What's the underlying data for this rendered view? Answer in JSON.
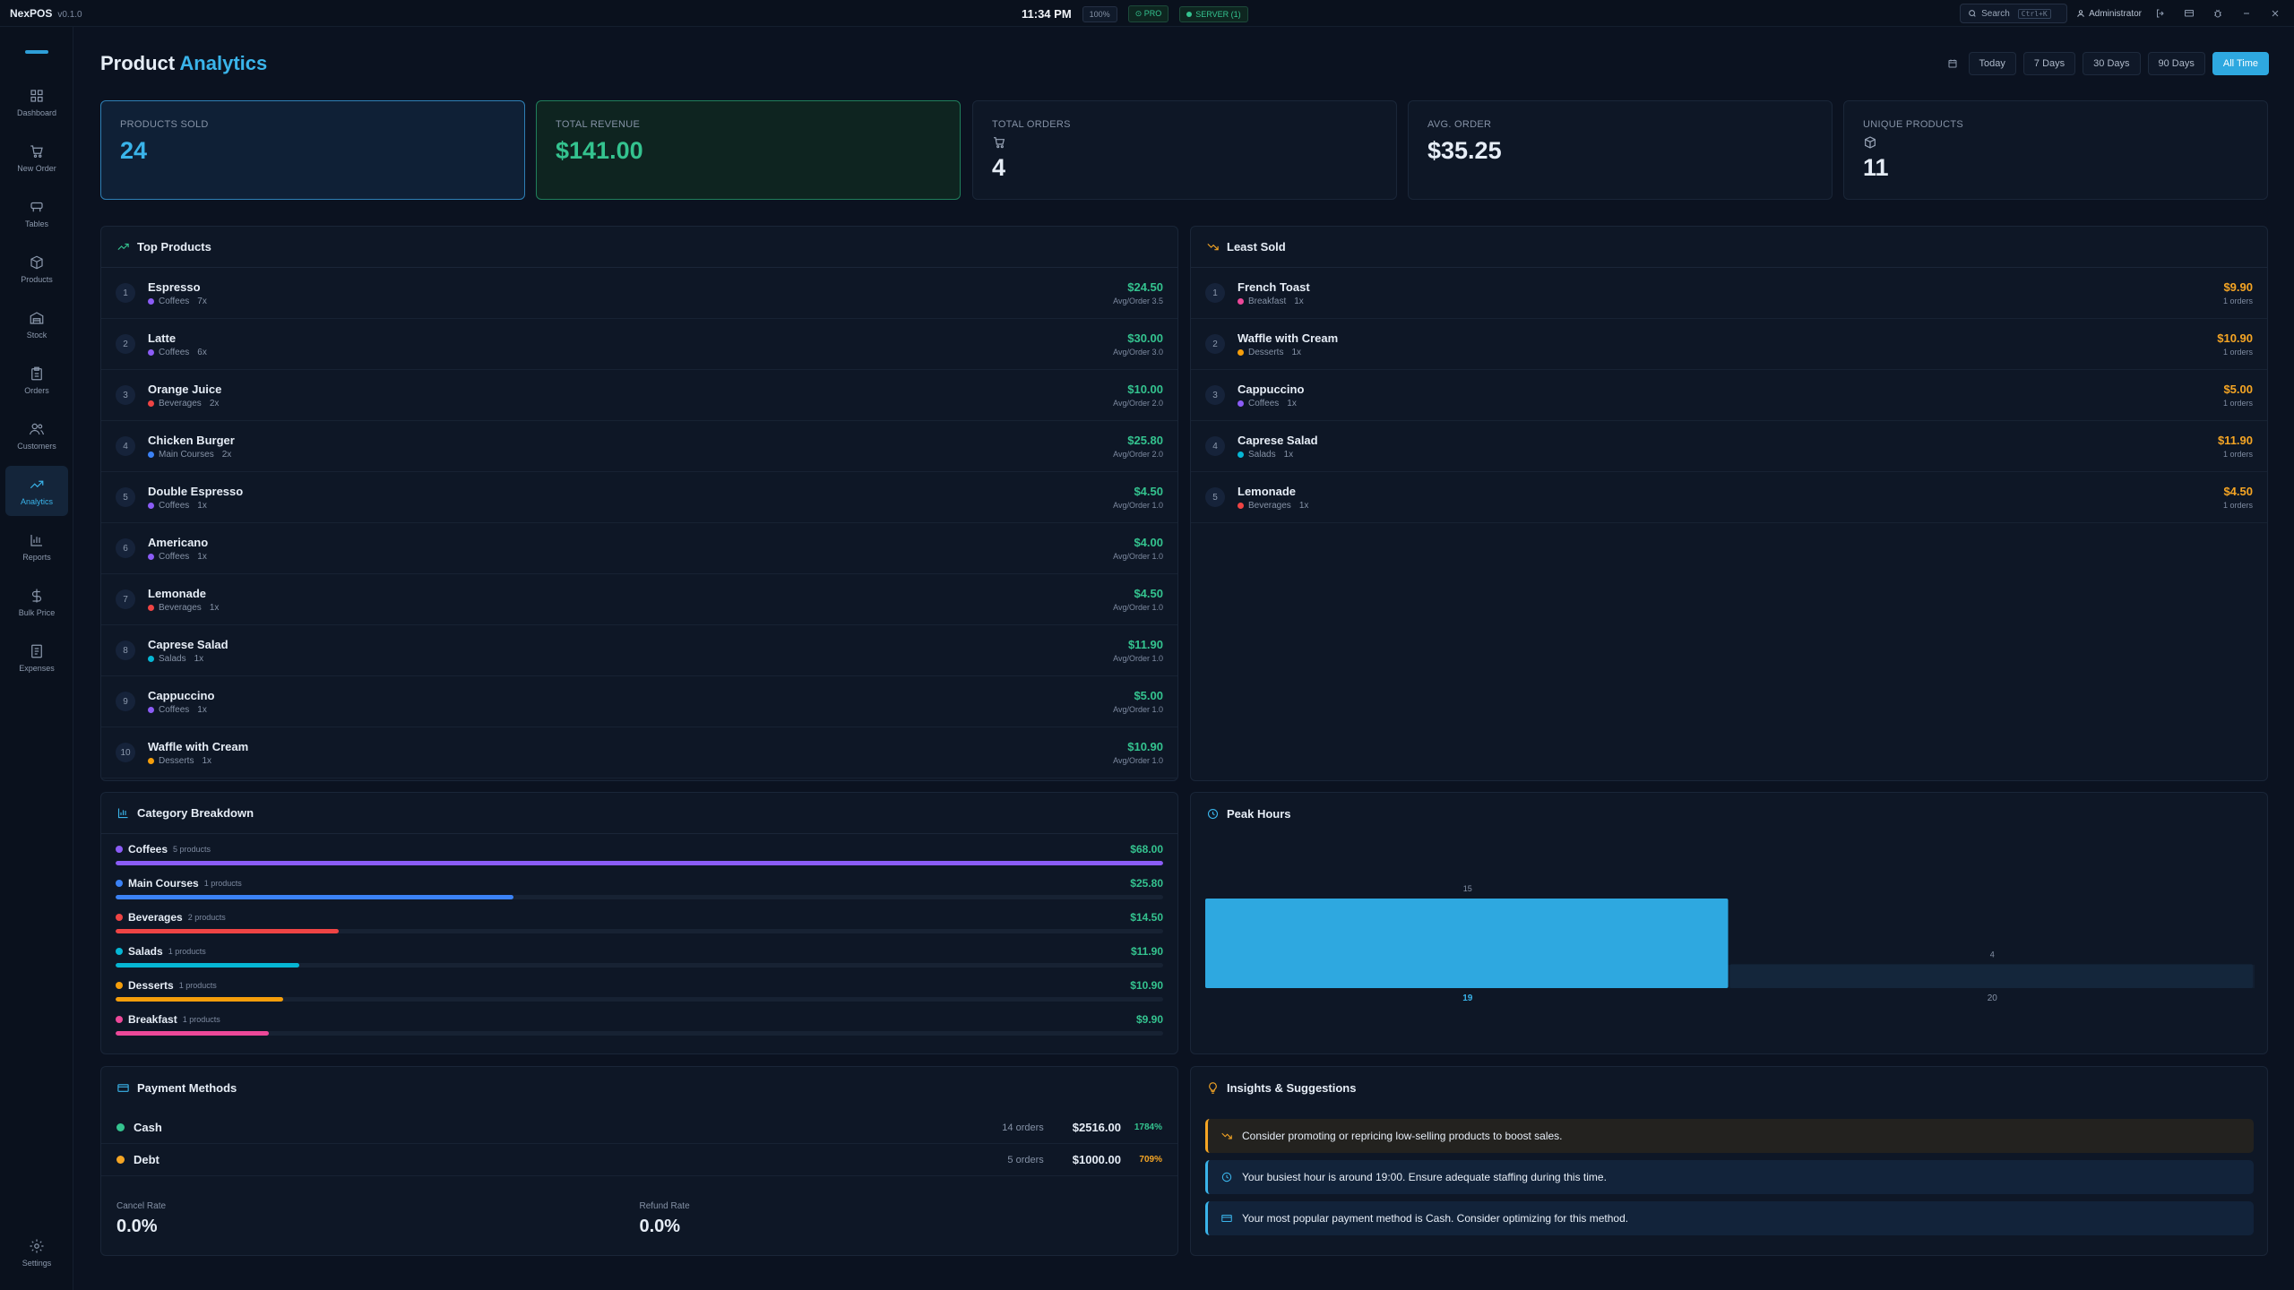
{
  "app": {
    "name": "NexPOS",
    "version": "v0.1.0"
  },
  "topbar": {
    "time": "11:34 PM",
    "zoom": "100%",
    "pro": "PRO",
    "server": "SERVER (1)",
    "search_label": "Search",
    "search_shortcut": "Ctrl+K",
    "user": "Administrator"
  },
  "sidebar": {
    "items": [
      {
        "label": "Dashboard",
        "icon": "grid-icon"
      },
      {
        "label": "New Order",
        "icon": "cart-icon"
      },
      {
        "label": "Tables",
        "icon": "table-icon"
      },
      {
        "label": "Products",
        "icon": "box-icon"
      },
      {
        "label": "Stock",
        "icon": "warehouse-icon"
      },
      {
        "label": "Orders",
        "icon": "clipboard-icon"
      },
      {
        "label": "Customers",
        "icon": "users-icon"
      },
      {
        "label": "Analytics",
        "icon": "trending-icon"
      },
      {
        "label": "Reports",
        "icon": "bar-chart-icon"
      },
      {
        "label": "Bulk Price",
        "icon": "dollar-icon"
      },
      {
        "label": "Expenses",
        "icon": "receipt-icon"
      }
    ],
    "active": "Analytics",
    "settings_label": "Settings"
  },
  "page": {
    "title_main": "Product",
    "title_accent": "Analytics",
    "ranges": [
      "Today",
      "7 Days",
      "30 Days",
      "90 Days",
      "All Time"
    ],
    "active_range": "All Time"
  },
  "stats": [
    {
      "label": "PRODUCTS SOLD",
      "value": "24"
    },
    {
      "label": "TOTAL REVENUE",
      "value": "$141.00"
    },
    {
      "label": "TOTAL ORDERS",
      "value": "4"
    },
    {
      "label": "AVG. ORDER",
      "value": "$35.25"
    },
    {
      "label": "UNIQUE PRODUCTS",
      "value": "11"
    }
  ],
  "colors": {
    "Coffees": "#8b5cf6",
    "Main Courses": "#3b82f6",
    "Beverages": "#ef4444",
    "Salads": "#06b6d4",
    "Desserts": "#f59e0b",
    "Breakfast": "#ec4899",
    "accent": "#2ea8e0",
    "success": "#34c38f",
    "warning": "#f5a524"
  },
  "top_products": {
    "title": "Top Products",
    "items": [
      {
        "rank": "1",
        "name": "Espresso",
        "category": "Coffees",
        "qty": "7x",
        "price": "$24.50",
        "avg": "Avg/Order 3.5"
      },
      {
        "rank": "2",
        "name": "Latte",
        "category": "Coffees",
        "qty": "6x",
        "price": "$30.00",
        "avg": "Avg/Order 3.0"
      },
      {
        "rank": "3",
        "name": "Orange Juice",
        "category": "Beverages",
        "qty": "2x",
        "price": "$10.00",
        "avg": "Avg/Order 2.0"
      },
      {
        "rank": "4",
        "name": "Chicken Burger",
        "category": "Main Courses",
        "qty": "2x",
        "price": "$25.80",
        "avg": "Avg/Order 2.0"
      },
      {
        "rank": "5",
        "name": "Double Espresso",
        "category": "Coffees",
        "qty": "1x",
        "price": "$4.50",
        "avg": "Avg/Order 1.0"
      },
      {
        "rank": "6",
        "name": "Americano",
        "category": "Coffees",
        "qty": "1x",
        "price": "$4.00",
        "avg": "Avg/Order 1.0"
      },
      {
        "rank": "7",
        "name": "Lemonade",
        "category": "Beverages",
        "qty": "1x",
        "price": "$4.50",
        "avg": "Avg/Order 1.0"
      },
      {
        "rank": "8",
        "name": "Caprese Salad",
        "category": "Salads",
        "qty": "1x",
        "price": "$11.90",
        "avg": "Avg/Order 1.0"
      },
      {
        "rank": "9",
        "name": "Cappuccino",
        "category": "Coffees",
        "qty": "1x",
        "price": "$5.00",
        "avg": "Avg/Order 1.0"
      },
      {
        "rank": "10",
        "name": "Waffle with Cream",
        "category": "Desserts",
        "qty": "1x",
        "price": "$10.90",
        "avg": "Avg/Order 1.0"
      }
    ]
  },
  "least_sold": {
    "title": "Least Sold",
    "items": [
      {
        "rank": "1",
        "name": "French Toast",
        "category": "Breakfast",
        "qty": "1x",
        "price": "$9.90",
        "sub": "1 orders"
      },
      {
        "rank": "2",
        "name": "Waffle with Cream",
        "category": "Desserts",
        "qty": "1x",
        "price": "$10.90",
        "sub": "1 orders"
      },
      {
        "rank": "3",
        "name": "Cappuccino",
        "category": "Coffees",
        "qty": "1x",
        "price": "$5.00",
        "sub": "1 orders"
      },
      {
        "rank": "4",
        "name": "Caprese Salad",
        "category": "Salads",
        "qty": "1x",
        "price": "$11.90",
        "sub": "1 orders"
      },
      {
        "rank": "5",
        "name": "Lemonade",
        "category": "Beverages",
        "qty": "1x",
        "price": "$4.50",
        "sub": "1 orders"
      }
    ]
  },
  "category_breakdown": {
    "title": "Category Breakdown",
    "items": [
      {
        "name": "Coffees",
        "count": "5 products",
        "value": "$68.00",
        "share": 1.0
      },
      {
        "name": "Main Courses",
        "count": "1 products",
        "value": "$25.80",
        "share": 0.38
      },
      {
        "name": "Beverages",
        "count": "2 products",
        "value": "$14.50",
        "share": 0.213
      },
      {
        "name": "Salads",
        "count": "1 products",
        "value": "$11.90",
        "share": 0.175
      },
      {
        "name": "Desserts",
        "count": "1 products",
        "value": "$10.90",
        "share": 0.16
      },
      {
        "name": "Breakfast",
        "count": "1 products",
        "value": "$9.90",
        "share": 0.146
      }
    ]
  },
  "chart_data": {
    "type": "bar",
    "title": "Peak Hours",
    "categories": [
      "19",
      "20"
    ],
    "values": [
      15,
      4
    ],
    "ylim": [
      0,
      15
    ],
    "highlight": "19"
  },
  "payment_methods": {
    "title": "Payment Methods",
    "items": [
      {
        "name": "Cash",
        "orders": "14 orders",
        "amount": "$2516.00",
        "pct": "1784%",
        "color": "#34c38f"
      },
      {
        "name": "Debt",
        "orders": "5 orders",
        "amount": "$1000.00",
        "pct": "709%",
        "color": "#f5a524"
      }
    ],
    "cancel_label": "Cancel Rate",
    "cancel_value": "0.0%",
    "refund_label": "Refund Rate",
    "refund_value": "0.0%"
  },
  "insights": {
    "title": "Insights & Suggestions",
    "items": [
      {
        "text": "Consider promoting or repricing low-selling products to boost sales.",
        "kind": "warn"
      },
      {
        "text": "Your busiest hour is around 19:00. Ensure adequate staffing during this time.",
        "kind": "info"
      },
      {
        "text": "Your most popular payment method is Cash. Consider optimizing for this method.",
        "kind": "info"
      }
    ]
  }
}
